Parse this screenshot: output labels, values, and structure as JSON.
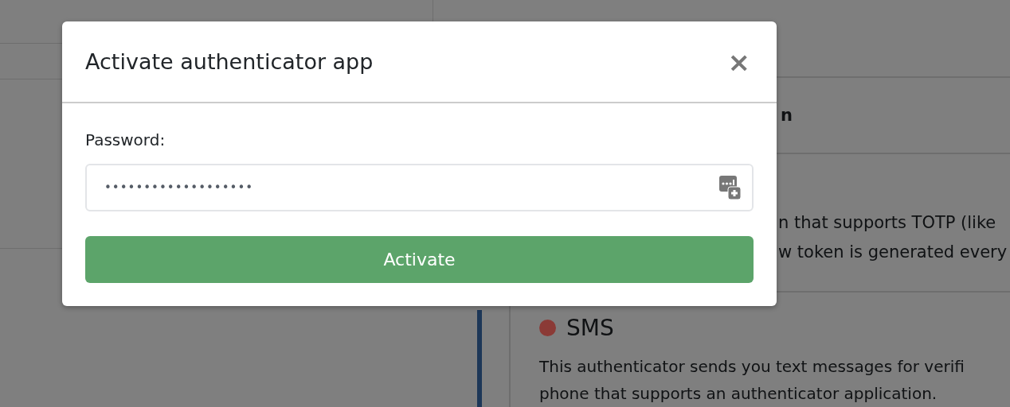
{
  "background": {
    "sections": [
      {
        "kind": "heading",
        "text": "n"
      },
      {
        "kind": "text",
        "lines": [
          "n that supports TOTP (like",
          "w token is generated every"
        ]
      },
      {
        "kind": "method",
        "title": "SMS",
        "color": "#8b3a36",
        "lines": [
          "This authenticator sends you text messages for verifi",
          "phone that supports an authenticator application."
        ]
      }
    ]
  },
  "modal": {
    "title": "Activate authenticator app",
    "close": "×",
    "field": {
      "label": "Password:",
      "value": "•••••••••••••••••••"
    },
    "button": "Activate"
  }
}
